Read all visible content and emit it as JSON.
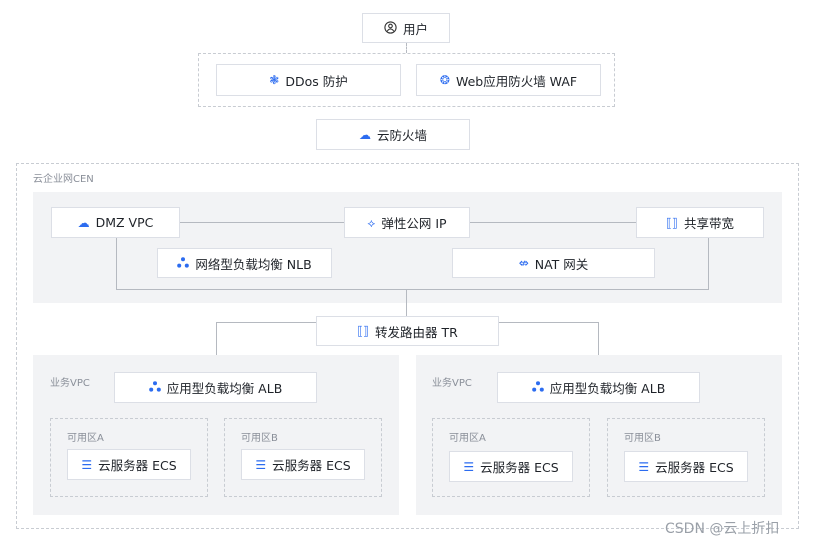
{
  "nodes": {
    "user": "用户",
    "ddos": "DDos 防护",
    "waf": "Web应用防火墙 WAF",
    "cloud_firewall": "云防火墙",
    "dmz_vpc": "DMZ VPC",
    "eip": "弹性公网 IP",
    "shared_bw": "共享带宽",
    "nlb": "网络型负载均衡 NLB",
    "nat": "NAT 网关",
    "tr": "转发路由器 TR",
    "alb_left": "应用型负载均衡 ALB",
    "alb_right": "应用型负载均衡 ALB",
    "ecs_la": "云服务器 ECS",
    "ecs_lb": "云服务器 ECS",
    "ecs_ra": "云服务器 ECS",
    "ecs_rb": "云服务器 ECS"
  },
  "labels": {
    "cen": "云企业网CEN",
    "vpc_left": "业务VPC",
    "vpc_right": "业务VPC",
    "zone_la": "可用区A",
    "zone_lb": "可用区B",
    "zone_ra": "可用区A",
    "zone_rb": "可用区B"
  },
  "watermark": "CSDN @云上折扣",
  "icons": {
    "user": "user-circle-icon",
    "ddos": "shield-icon",
    "waf": "shield-icon",
    "cloud_firewall": "cloud-firewall-icon",
    "dmz_vpc": "cloud-icon",
    "eip": "eip-icon",
    "shared_bw": "bandwidth-icon",
    "nlb": "load-balancer-icon",
    "nat": "nat-gateway-icon",
    "tr": "router-icon",
    "alb": "load-balancer-icon",
    "ecs": "server-icon"
  },
  "colors": {
    "accent": "#2c6cf0",
    "panel": "#f2f3f5",
    "border": "#dcdfe6"
  }
}
